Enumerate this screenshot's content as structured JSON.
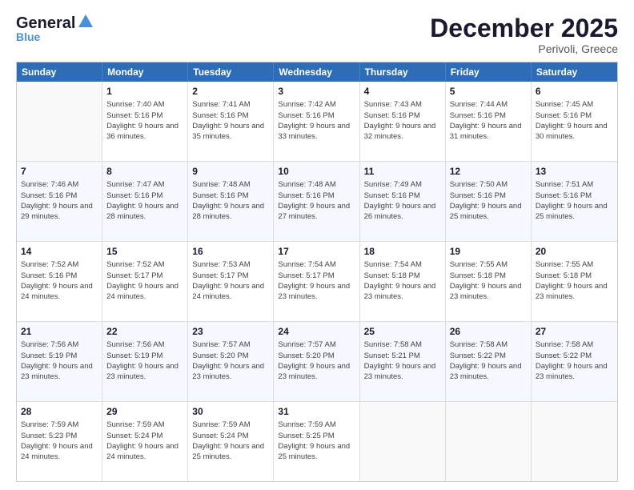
{
  "header": {
    "logo_general": "General",
    "logo_blue": "Blue",
    "month_title": "December 2025",
    "location": "Perivoli, Greece"
  },
  "weekdays": [
    "Sunday",
    "Monday",
    "Tuesday",
    "Wednesday",
    "Thursday",
    "Friday",
    "Saturday"
  ],
  "weeks": [
    [
      {
        "day": "",
        "empty": true
      },
      {
        "day": "1",
        "sunrise": "7:40 AM",
        "sunset": "5:16 PM",
        "daylight": "9 hours and 36 minutes."
      },
      {
        "day": "2",
        "sunrise": "7:41 AM",
        "sunset": "5:16 PM",
        "daylight": "9 hours and 35 minutes."
      },
      {
        "day": "3",
        "sunrise": "7:42 AM",
        "sunset": "5:16 PM",
        "daylight": "9 hours and 33 minutes."
      },
      {
        "day": "4",
        "sunrise": "7:43 AM",
        "sunset": "5:16 PM",
        "daylight": "9 hours and 32 minutes."
      },
      {
        "day": "5",
        "sunrise": "7:44 AM",
        "sunset": "5:16 PM",
        "daylight": "9 hours and 31 minutes."
      },
      {
        "day": "6",
        "sunrise": "7:45 AM",
        "sunset": "5:16 PM",
        "daylight": "9 hours and 30 minutes."
      }
    ],
    [
      {
        "day": "7",
        "sunrise": "7:46 AM",
        "sunset": "5:16 PM",
        "daylight": "9 hours and 29 minutes."
      },
      {
        "day": "8",
        "sunrise": "7:47 AM",
        "sunset": "5:16 PM",
        "daylight": "9 hours and 28 minutes."
      },
      {
        "day": "9",
        "sunrise": "7:48 AM",
        "sunset": "5:16 PM",
        "daylight": "9 hours and 28 minutes."
      },
      {
        "day": "10",
        "sunrise": "7:48 AM",
        "sunset": "5:16 PM",
        "daylight": "9 hours and 27 minutes."
      },
      {
        "day": "11",
        "sunrise": "7:49 AM",
        "sunset": "5:16 PM",
        "daylight": "9 hours and 26 minutes."
      },
      {
        "day": "12",
        "sunrise": "7:50 AM",
        "sunset": "5:16 PM",
        "daylight": "9 hours and 25 minutes."
      },
      {
        "day": "13",
        "sunrise": "7:51 AM",
        "sunset": "5:16 PM",
        "daylight": "9 hours and 25 minutes."
      }
    ],
    [
      {
        "day": "14",
        "sunrise": "7:52 AM",
        "sunset": "5:16 PM",
        "daylight": "9 hours and 24 minutes."
      },
      {
        "day": "15",
        "sunrise": "7:52 AM",
        "sunset": "5:17 PM",
        "daylight": "9 hours and 24 minutes."
      },
      {
        "day": "16",
        "sunrise": "7:53 AM",
        "sunset": "5:17 PM",
        "daylight": "9 hours and 24 minutes."
      },
      {
        "day": "17",
        "sunrise": "7:54 AM",
        "sunset": "5:17 PM",
        "daylight": "9 hours and 23 minutes."
      },
      {
        "day": "18",
        "sunrise": "7:54 AM",
        "sunset": "5:18 PM",
        "daylight": "9 hours and 23 minutes."
      },
      {
        "day": "19",
        "sunrise": "7:55 AM",
        "sunset": "5:18 PM",
        "daylight": "9 hours and 23 minutes."
      },
      {
        "day": "20",
        "sunrise": "7:55 AM",
        "sunset": "5:18 PM",
        "daylight": "9 hours and 23 minutes."
      }
    ],
    [
      {
        "day": "21",
        "sunrise": "7:56 AM",
        "sunset": "5:19 PM",
        "daylight": "9 hours and 23 minutes."
      },
      {
        "day": "22",
        "sunrise": "7:56 AM",
        "sunset": "5:19 PM",
        "daylight": "9 hours and 23 minutes."
      },
      {
        "day": "23",
        "sunrise": "7:57 AM",
        "sunset": "5:20 PM",
        "daylight": "9 hours and 23 minutes."
      },
      {
        "day": "24",
        "sunrise": "7:57 AM",
        "sunset": "5:20 PM",
        "daylight": "9 hours and 23 minutes."
      },
      {
        "day": "25",
        "sunrise": "7:58 AM",
        "sunset": "5:21 PM",
        "daylight": "9 hours and 23 minutes."
      },
      {
        "day": "26",
        "sunrise": "7:58 AM",
        "sunset": "5:22 PM",
        "daylight": "9 hours and 23 minutes."
      },
      {
        "day": "27",
        "sunrise": "7:58 AM",
        "sunset": "5:22 PM",
        "daylight": "9 hours and 23 minutes."
      }
    ],
    [
      {
        "day": "28",
        "sunrise": "7:59 AM",
        "sunset": "5:23 PM",
        "daylight": "9 hours and 24 minutes."
      },
      {
        "day": "29",
        "sunrise": "7:59 AM",
        "sunset": "5:24 PM",
        "daylight": "9 hours and 24 minutes."
      },
      {
        "day": "30",
        "sunrise": "7:59 AM",
        "sunset": "5:24 PM",
        "daylight": "9 hours and 25 minutes."
      },
      {
        "day": "31",
        "sunrise": "7:59 AM",
        "sunset": "5:25 PM",
        "daylight": "9 hours and 25 minutes."
      },
      {
        "day": "",
        "empty": true
      },
      {
        "day": "",
        "empty": true
      },
      {
        "day": "",
        "empty": true
      }
    ]
  ]
}
